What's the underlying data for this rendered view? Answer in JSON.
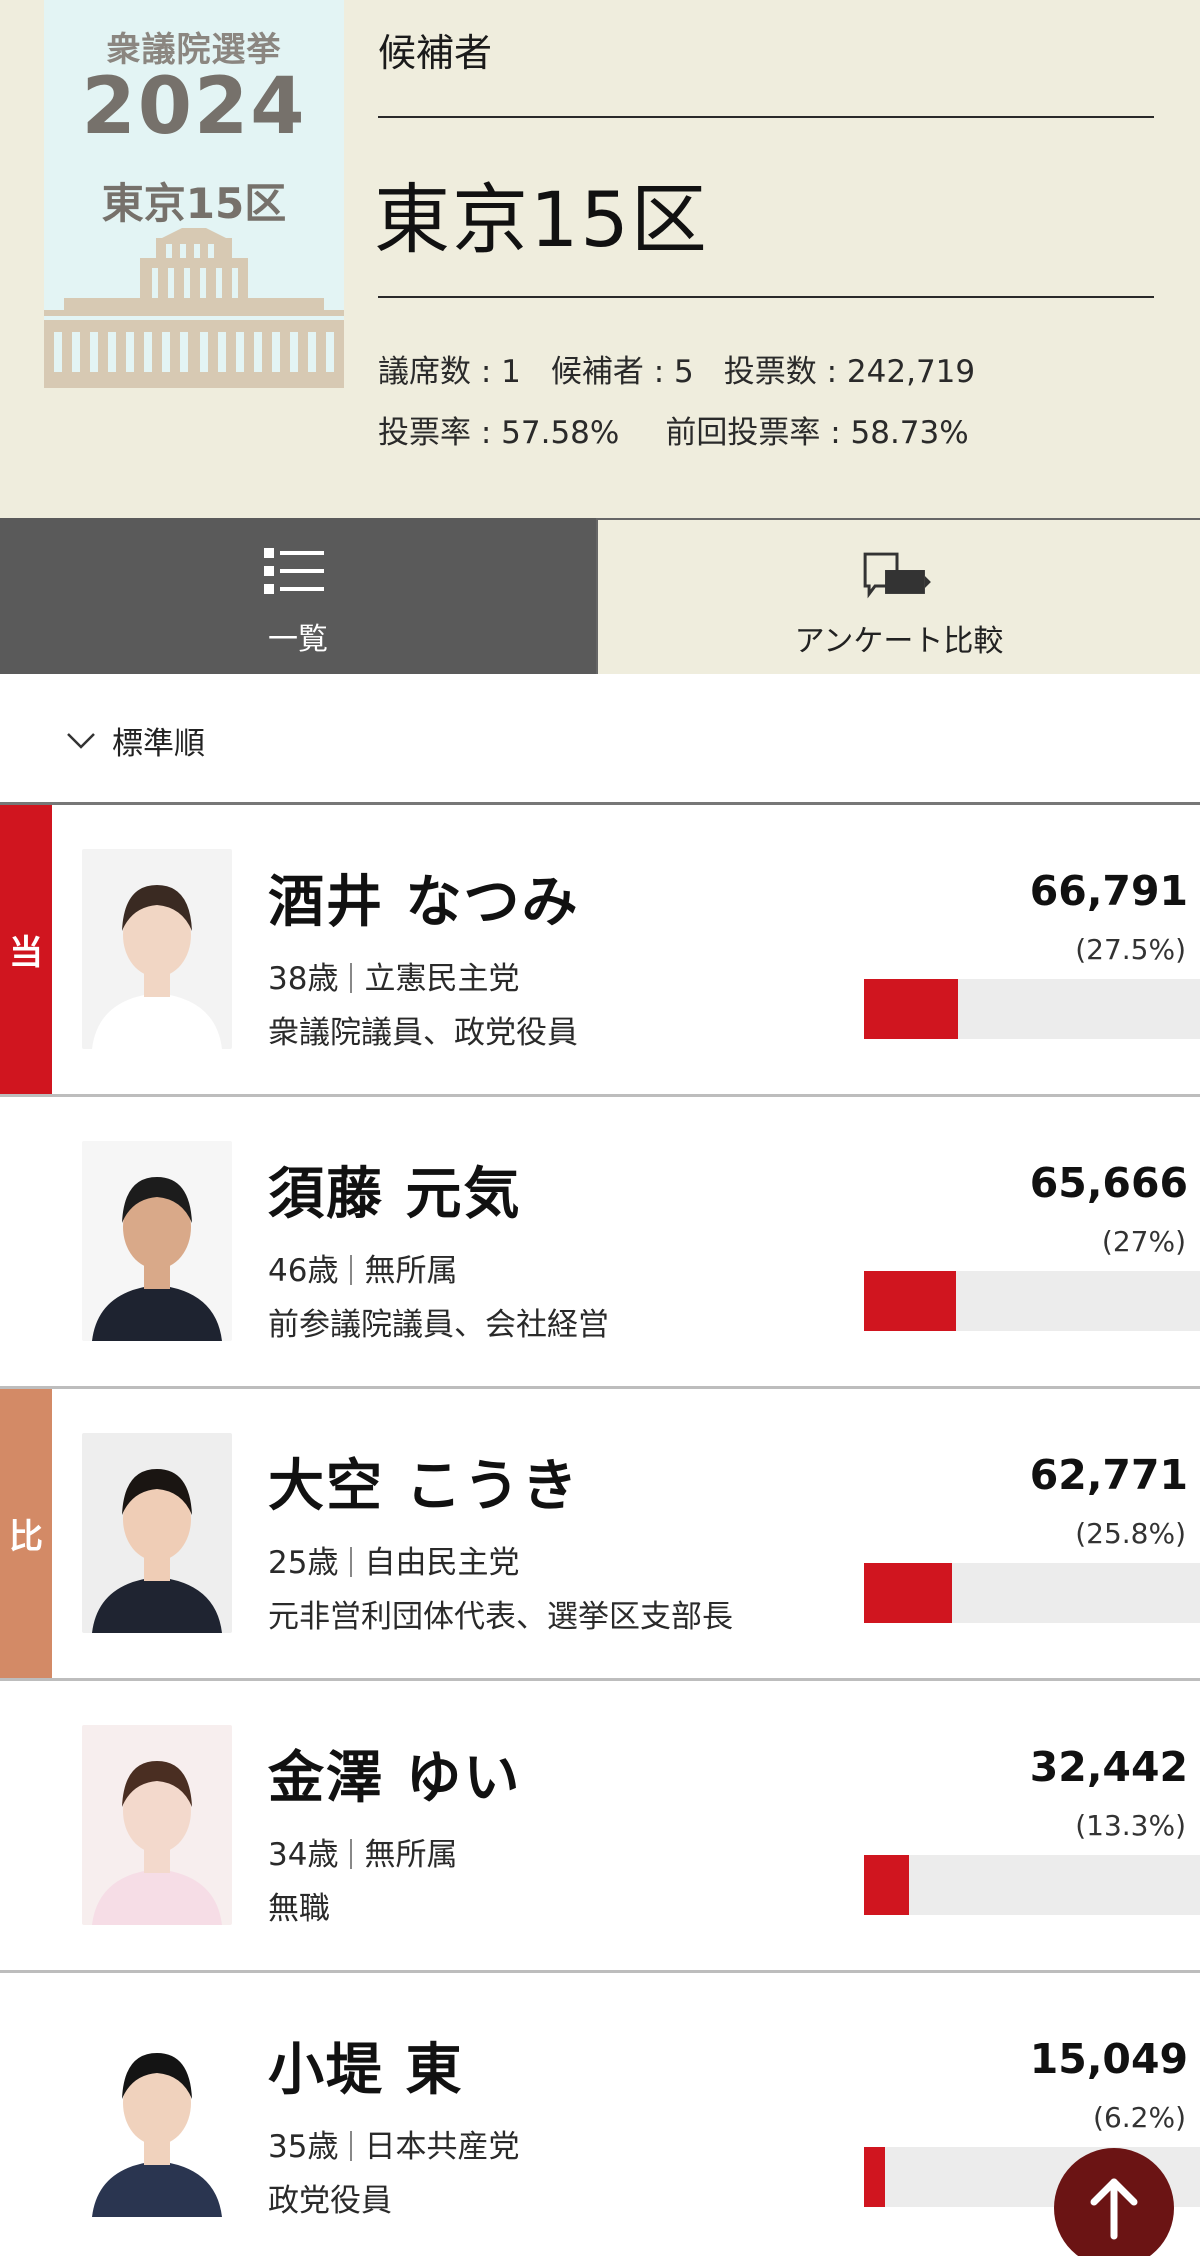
{
  "logo": {
    "line1": "衆議院選挙",
    "year": "2024",
    "district": "東京15区"
  },
  "header": {
    "label": "候補者",
    "title": "東京15区",
    "stats": {
      "seats": "議席数 : 1",
      "candidates": "候補者 : 5",
      "votes": "投票数 : 242,719",
      "turnout": "投票率 : 57.58%",
      "prev_turnout": "前回投票率 : 58.73%"
    }
  },
  "tabs": {
    "list_label": "一覧",
    "survey_label": "アンケート比較"
  },
  "sort": {
    "label": "標準順",
    "icon": "chevron-down-icon"
  },
  "colors": {
    "header_bg": "#efeddd",
    "elected_badge": "#d0151f",
    "pr_badge": "#d38a66",
    "bar": "#d0151f",
    "tab_active": "#5a5a5a",
    "to_top": "#6b1414"
  },
  "candidates": [
    {
      "name": "酒井 なつみ",
      "age": "38歳",
      "party": "立憲民主党",
      "career": "衆議院議員、政党役員",
      "votes": "66,791",
      "pct": "(27.5%)",
      "share": 0.275,
      "badge": "当",
      "badge_color": "#d0151f",
      "photo_bg": "#f3f3f3",
      "photo_skin": "#f1d6c4",
      "photo_hair": "#3a2a22",
      "photo_cloth": "#ffffff"
    },
    {
      "name": "須藤 元気",
      "age": "46歳",
      "party": "無所属",
      "career": "前参議院議員、会社経営",
      "votes": "65,666",
      "pct": "(27%)",
      "share": 0.27,
      "badge": "",
      "badge_color": "",
      "photo_bg": "#f6f6f6",
      "photo_skin": "#d9a989",
      "photo_hair": "#1c1c1c",
      "photo_cloth": "#1e2330"
    },
    {
      "name": "大空 こうき",
      "age": "25歳",
      "party": "自由民主党",
      "career": "元非営利団体代表、選挙区支部長",
      "votes": "62,771",
      "pct": "(25.8%)",
      "share": 0.258,
      "badge": "比",
      "badge_color": "#d38a66",
      "photo_bg": "#eeeeee",
      "photo_skin": "#efcdb6",
      "photo_hair": "#1a1512",
      "photo_cloth": "#1f2431"
    },
    {
      "name": "金澤 ゆい",
      "age": "34歳",
      "party": "無所属",
      "career": "無職",
      "votes": "32,442",
      "pct": "(13.3%)",
      "share": 0.133,
      "badge": "",
      "badge_color": "",
      "photo_bg": "#f7eeee",
      "photo_skin": "#f3d9cc",
      "photo_hair": "#4a2e22",
      "photo_cloth": "#f6dde6"
    },
    {
      "name": "小堤 東",
      "age": "35歳",
      "party": "日本共産党",
      "career": "政党役員",
      "votes": "15,049",
      "pct": "(6.2%)",
      "share": 0.062,
      "badge": "",
      "badge_color": "",
      "photo_bg": "#ffffff",
      "photo_skin": "#f0d2bd",
      "photo_hair": "#141414",
      "photo_cloth": "#2a3550"
    }
  ],
  "back_to_top": {
    "icon": "arrow-up-icon"
  }
}
